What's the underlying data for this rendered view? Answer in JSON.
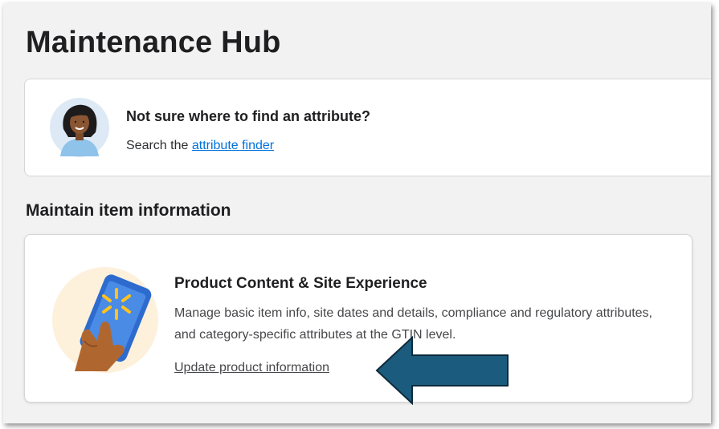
{
  "page": {
    "title": "Maintenance Hub"
  },
  "finder": {
    "heading": "Not sure where to find an attribute?",
    "text_prefix": "Search the",
    "link_label": "attribute finder",
    "avatar_icon": "person-avatar-icon"
  },
  "section": {
    "title": "Maintain item information"
  },
  "card": {
    "title": "Product Content & Site Experience",
    "description": "Manage basic item info, site dates and details, compliance and regulatory attributes, and category-specific attributes at the GTIN level.",
    "link_label": "Update product information",
    "illustration_icon": "hand-holding-phone-icon"
  },
  "annotation": {
    "arrow_icon": "left-arrow-icon",
    "arrow_color": "#1b5b7d"
  },
  "colors": {
    "link_blue": "#0071dc",
    "page_bg": "#f2f2f2",
    "spark_yellow": "#ffc220"
  }
}
